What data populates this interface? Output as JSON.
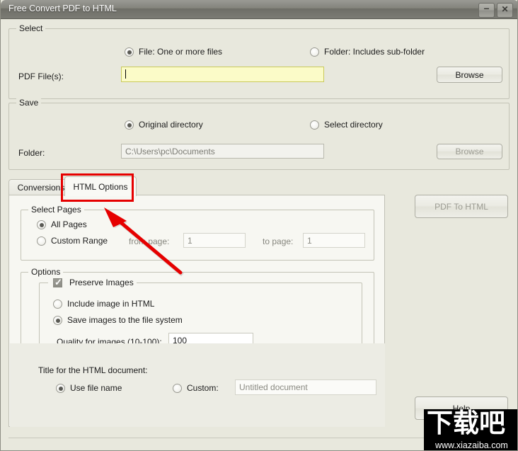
{
  "window": {
    "title": "Free Convert PDF to HTML",
    "minimize_glyph": "–",
    "close_glyph": "✕"
  },
  "select_group": {
    "legend": "Select",
    "radio_file_label": "File:  One or more files",
    "radio_folder_label": "Folder: Includes sub-folder",
    "pdf_files_label": "PDF File(s):",
    "pdf_files_value": "",
    "browse_label": "Browse"
  },
  "save_group": {
    "legend": "Save",
    "radio_original_label": "Original directory",
    "radio_select_label": "Select directory",
    "folder_label": "Folder:",
    "folder_value": "C:\\Users\\pc\\Documents",
    "browse_label": "Browse"
  },
  "tabs": [
    {
      "label": "Conversions",
      "active": false
    },
    {
      "label": "HTML Options",
      "active": true
    }
  ],
  "select_pages": {
    "legend": "Select Pages",
    "all_pages_label": "All Pages",
    "custom_range_label": "Custom Range",
    "from_page_label": "from page:",
    "from_page_value": "1",
    "to_page_label": "to page:",
    "to_page_value": "1"
  },
  "options": {
    "legend": "Options",
    "preserve_images_label": "Preserve Images",
    "preserve_images_tick": "✓",
    "include_image_label": "Include image in HTML",
    "save_images_label": "Save images to the file system",
    "quality_label": "Quality for images (10-100):",
    "quality_value": "100"
  },
  "title_section": {
    "label": "Title for the HTML document:",
    "use_file_name_label": "Use file name",
    "custom_label": "Custom:",
    "custom_placeholder": "Untitled document"
  },
  "actions": {
    "convert_label": "PDF To HTML",
    "help_label": "Help"
  },
  "watermark": {
    "logo_text": "下载吧",
    "url": "www.xiazaiba.com"
  },
  "colors": {
    "window_bg": "#e8e8dd",
    "titlebar": "#83837c",
    "accent_field": "#fbfbc8",
    "annotation": "#e60000"
  }
}
